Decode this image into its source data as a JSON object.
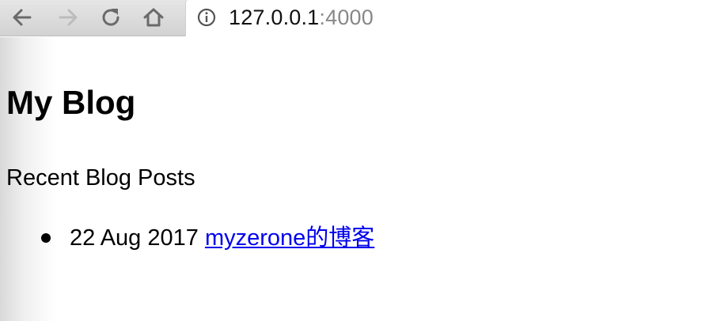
{
  "browser": {
    "url_host": "127.0.0.1",
    "url_port": ":4000",
    "icons": [
      "back-arrow-icon",
      "forward-arrow-icon",
      "reload-icon",
      "home-icon",
      "info-icon"
    ]
  },
  "page": {
    "title": "My Blog",
    "section_title": "Recent Blog Posts",
    "posts": [
      {
        "date": "22 Aug 2017",
        "title": "myzerone的博客"
      }
    ]
  }
}
